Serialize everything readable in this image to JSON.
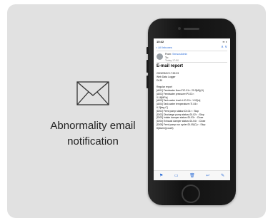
{
  "caption": {
    "line1": "Abnormality email",
    "line2": "notification"
  },
  "phone": {
    "status_time": "15:42",
    "status_icons": "▪▪ ◗",
    "nav_back": "< All Inboxes",
    "nav_arrows": "∧ ∨",
    "from_label": "From:",
    "from_sender": "SensorAdmin",
    "to_label": "To:",
    "date": "Today 17:50",
    "subject": "E-mail report",
    "body_lines": [
      "2023/03/02 17:52:03",
      "Web Data Logger",
      "DL30",
      "",
      "Regular report",
      "[AI01] Feedwater flow<FIC-01>: 20.0[t/h](H)",
      "[AI02] Feedwater pressure<PI-02>:",
      "0.16[MPa]",
      "[AI03] Tank water level<LIC-03>: 1.02[m]",
      "[AI04] Tank water temperature<TI-04>:",
      "6.2[deg.C]",
      "[DI01] Feed pump status<DI-01> : Stop",
      "[DI02] Discharge pump status<DI-02> : Stop",
      "[DI03] Intake damper status<DI-03> : Close",
      "[DI04] Exhaust damper status<DI-04> : Close",
      "[DI05] Feed pump run cycle<DI-05(C)> : Stop",
      "8(Alarm)(count)"
    ],
    "toolbar_icons": [
      "flag-icon",
      "folder-icon",
      "trash-icon",
      "reply-icon",
      "compose-icon"
    ]
  },
  "colors": {
    "card_bg": "#e1e1e1",
    "accent_blue": "#2f6fd8"
  }
}
